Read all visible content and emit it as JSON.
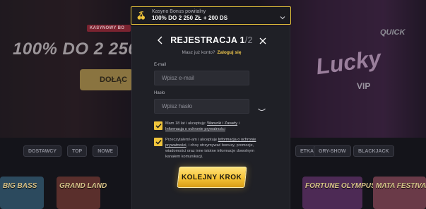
{
  "background": {
    "promo_tag": "KASYNOWY BO",
    "promo_headline": "100% DO 2 250",
    "promo_button": "DOŁĄC",
    "lucky_text": "Lucky",
    "quick_text": "QUICK",
    "vip_text": "VIP",
    "nav_left": [
      "DOSTAWCY",
      "TOP",
      "NOWE"
    ],
    "nav_right": [
      "ETKA",
      "GRY-SHOW",
      "BLACKJACK"
    ],
    "tiles": [
      "BIG BASS",
      "GRAND LAND",
      "",
      "FORTUNE OLYMPUS",
      "MATA FESTIVAL"
    ]
  },
  "bonus_bar": {
    "icon": "cherry-icon",
    "label": "Kasyno Bonus powitalny",
    "value": "100% DO 2 250 ZŁ + 200 DS",
    "border_color": "#e6c33b"
  },
  "modal": {
    "title_prefix": "REJESTRACJA ",
    "title_step": "1",
    "title_total": "/2",
    "login_prompt": "Masz już konto?",
    "login_link": "Zaloguj się",
    "email": {
      "label": "E-mail",
      "placeholder": "Wpisz e-mail"
    },
    "password": {
      "label": "Hasło",
      "placeholder": "Wpisz hasło"
    },
    "consent_1": {
      "checked": true,
      "text_before": "Mam 18 lat i akceptuję: ",
      "link_terms": "Warunki i Zasady",
      "text_mid": " i ",
      "link_privacy": "Informacja o ochronie prywatności"
    },
    "consent_2": {
      "checked": true,
      "text_before": "Przeczytałem/-am i akceptuję ",
      "link_privacy": "Informacja o ochronie prywatności",
      "text_after": ", i chcę otrzymywać bonusy, promocje, wiadomości oraz inne istotne informacje dowolnym kanałem komunikacji."
    },
    "cta_label": "KOLEJNY KROK"
  },
  "colors": {
    "accent": "#f0c53c",
    "modal_bg": "#1f2026",
    "input_bg": "#2b2c33"
  }
}
